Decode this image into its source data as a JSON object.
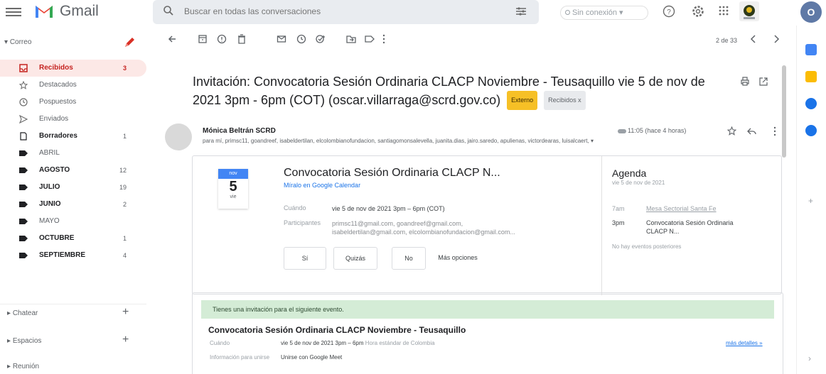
{
  "header": {
    "brand": "Gmail",
    "search_placeholder": "Buscar en todas las conversaciones",
    "status": "Sin conexión",
    "avatar_letter": "O"
  },
  "nav": {
    "mail_section": "Correo",
    "items": [
      {
        "label": "Recibidos",
        "count": "3"
      },
      {
        "label": "Destacados",
        "count": ""
      },
      {
        "label": "Pospuestos",
        "count": ""
      },
      {
        "label": "Enviados",
        "count": ""
      },
      {
        "label": "Borradores",
        "count": "1"
      },
      {
        "label": "ABRIL",
        "count": ""
      },
      {
        "label": "AGOSTO",
        "count": "12"
      },
      {
        "label": "JULIO",
        "count": "19"
      },
      {
        "label": "JUNIO",
        "count": "2"
      },
      {
        "label": "MAYO",
        "count": ""
      },
      {
        "label": "OCTUBRE",
        "count": "1"
      },
      {
        "label": "SEPTIEMBRE",
        "count": "4"
      }
    ],
    "chat": "Chatear",
    "spaces": "Espacios",
    "meeting": "Reunión"
  },
  "toolbar": {
    "pager": "2 de 33"
  },
  "email": {
    "subject": "Invitación: Convocatoria Sesión Ordinaria CLACP Noviembre - Teusaquillo vie 5 de nov de 2021 3pm - 6pm (COT) (oscar.villarraga@scrd.gov.co)",
    "tag_external": "Externo",
    "tag_inbox": "Recibidos x",
    "sender": "Mónica Beltrán SCRD",
    "recipients": "para mí, primsc11, goandreef, isabeldertilan, elcolombianofundacion, santiagomonsalevella, juanita.dias, jairo.saredo, apulienas, victordearas, luisalcaert,",
    "time": "11:05 (hace 4 horas)"
  },
  "calendar_card": {
    "month": "nov",
    "day": "5",
    "weekday": "vie",
    "title": "Convocatoria Sesión Ordinaria CLACP N...",
    "link": "Míralo en Google Calendar",
    "when_label": "Cuándo",
    "when_value": "vie 5 de nov de 2021 3pm – 6pm (COT)",
    "participants_label": "Participantes",
    "participants_value": "primsc11@gmail.com, goandreef@gmail.com, isabeldertilan@gmail.com, elcolombianofundacion@gmail.com...",
    "btn_yes": "Sí",
    "btn_maybe": "Quizás",
    "btn_no": "No",
    "btn_more": "Más opciones",
    "agenda_title": "Agenda",
    "agenda_date": "vie 5 de nov de 2021",
    "agenda_items": [
      {
        "time": "7am",
        "title": "Mesa Sectorial Santa Fe"
      },
      {
        "time": "3pm",
        "title": "Convocatoria Sesión Ordinaria CLACP N..."
      }
    ],
    "agenda_none": "No hay eventos posteriores"
  },
  "invite_box": {
    "banner": "Tienes una invitación para el siguiente evento.",
    "title": "Convocatoria Sesión Ordinaria CLACP Noviembre - Teusaquillo",
    "when_label": "Cuándo",
    "when_value": "vie 5 de nov de 2021 3pm – 6pm",
    "when_tz": "Hora estándar de Colombia",
    "join_label": "Información para unirse",
    "join_value": "Unirse con Google Meet",
    "more_details": "más detalles »"
  },
  "colors": {
    "accent_red": "#c5221f",
    "selected_bg": "#fce8e6",
    "link_blue": "#1a73e8",
    "tag_yellow": "#f6c026",
    "banner_green": "#d4ecd6"
  }
}
